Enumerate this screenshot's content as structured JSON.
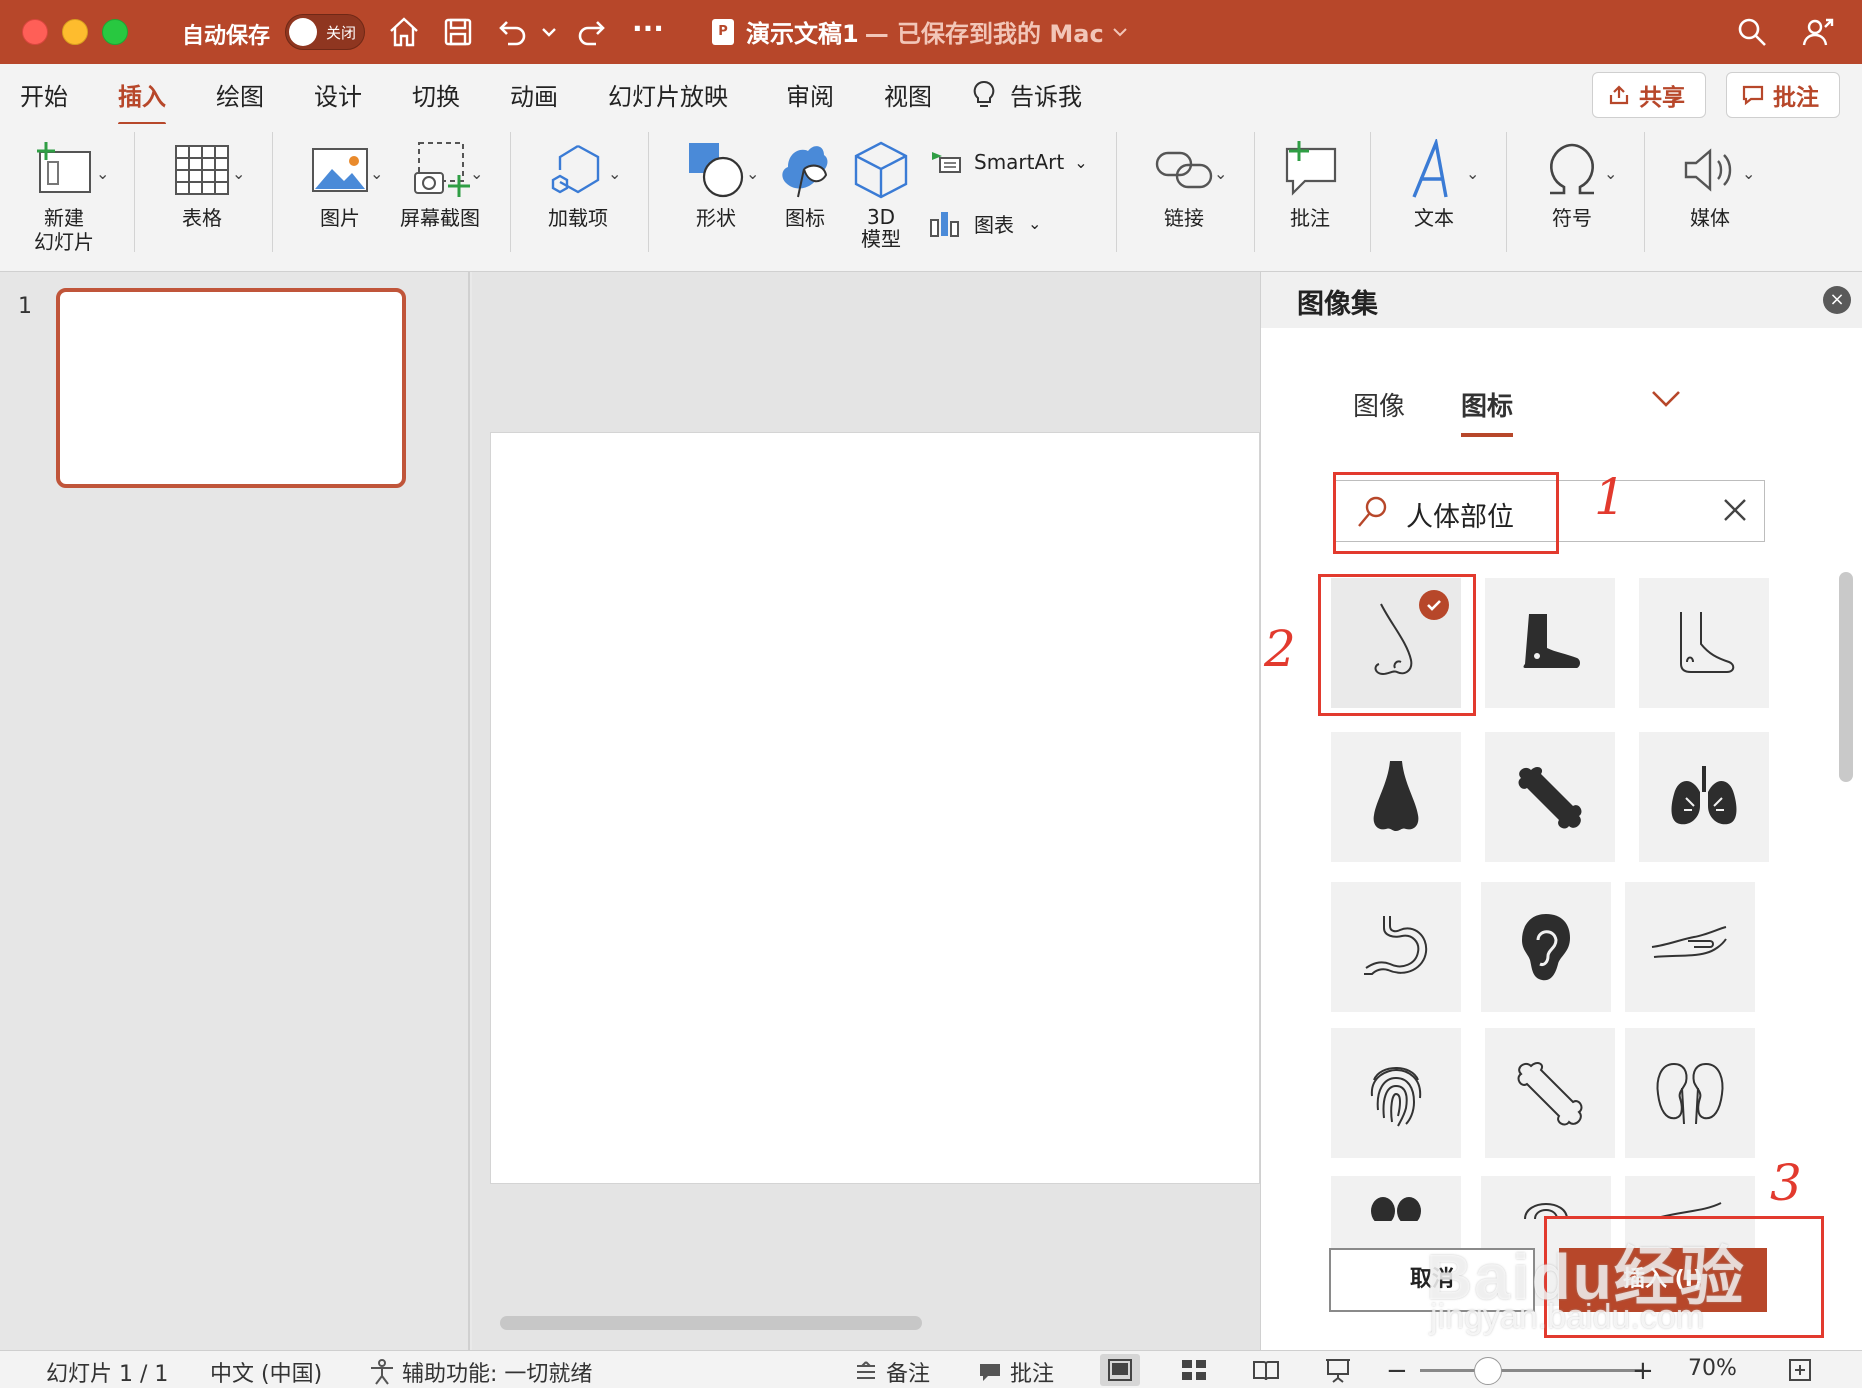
{
  "titlebar": {
    "autosave_label": "自动保存",
    "toggle_text": "关闭",
    "doc_badge": "P",
    "doc_name": "演示文稿1",
    "doc_saved": "— 已保存到我的 Mac",
    "more": "···"
  },
  "menu": {
    "tabs": [
      "开始",
      "插入",
      "绘图",
      "设计",
      "切换",
      "动画",
      "幻灯片放映",
      "审阅",
      "视图",
      "告诉我"
    ],
    "active": "插入",
    "share_label": "共享",
    "comment_label": "批注"
  },
  "ribbon": {
    "new_slide": [
      "新建",
      "幻灯片"
    ],
    "table": "表格",
    "picture": "图片",
    "screenshot": "屏幕截图",
    "addins": "加载项",
    "shapes": "形状",
    "icons": "图标",
    "model3d": [
      "3D",
      "模型"
    ],
    "smartart": "SmartArt",
    "chart": "图表",
    "link": "链接",
    "comment": "批注",
    "text": "文本",
    "symbol": "符号",
    "media": "媒体"
  },
  "thumbnails": {
    "slide_number": "1"
  },
  "panel": {
    "title": "图像集",
    "close": "×",
    "tabs": [
      "图像",
      "图标"
    ],
    "active_tab": "图标",
    "search_value": "人体部位",
    "icons": [
      "nose-outline-icon",
      "boot-icon",
      "foot-outline-icon",
      "nose-icon",
      "bone-icon",
      "lungs-icon",
      "stomach-icon",
      "ear-icon",
      "hand-icon",
      "fingerprint-icon",
      "bone-outline-icon",
      "kidneys-icon"
    ],
    "cancel_label": "取消",
    "insert_label": "插入 (I)"
  },
  "annotations": {
    "one": "1",
    "two": "2",
    "three": "3"
  },
  "watermark": {
    "line1": "Baidu经验",
    "line2": "jingyan.baidu.com"
  },
  "statusbar": {
    "slide_info": "幻灯片 1 / 1",
    "language": "中文 (中国)",
    "accessibility": "辅助功能: 一切就绪",
    "notes": "备注",
    "comments": "批注",
    "zoom_minus": "−",
    "zoom_plus": "+",
    "zoom": "70%"
  },
  "colors": {
    "accent": "#b7472a",
    "annotation": "#e23a2e"
  }
}
